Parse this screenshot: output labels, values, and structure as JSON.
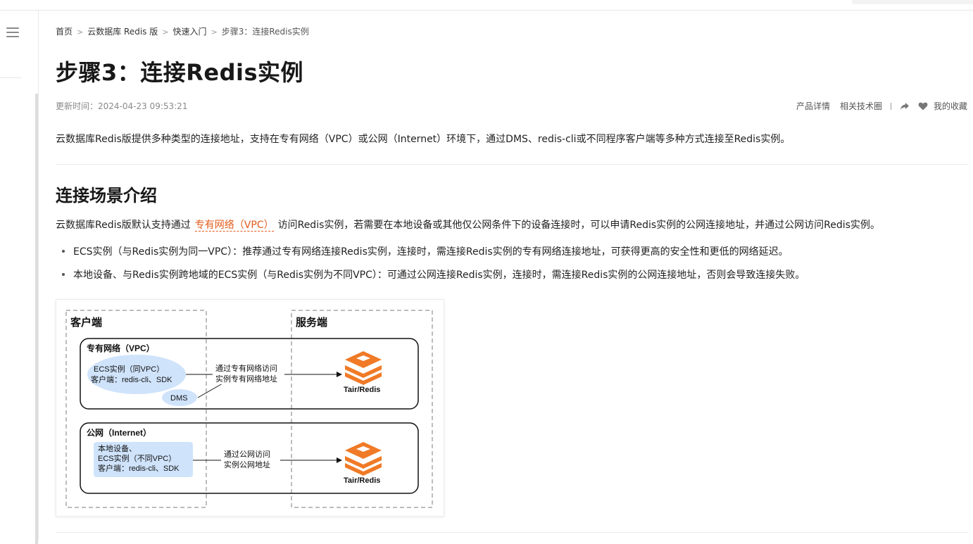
{
  "breadcrumb": {
    "items": [
      "首页",
      "云数据库 Redis 版",
      "快速入门"
    ],
    "current": "步骤3：连接Redis实例",
    "separator": ">"
  },
  "page": {
    "title": "步骤3：连接Redis实例",
    "updated": "更新时间：2024-04-23 09:53:21",
    "intro": "云数据库Redis版提供多种类型的连接地址，支持在专有网络（VPC）或公网（Internet）环境下，通过DMS、redis-cli或不同程序客户端等多种方式连接至Redis实例。"
  },
  "actions": {
    "product_detail": "产品详情",
    "tech_circle": "相关技术圈",
    "favorite": "我的收藏"
  },
  "section": {
    "heading": "连接场景介绍",
    "para_before": "云数据库Redis版默认支持通过",
    "para_link": "专有网络（VPC）",
    "para_after": "访问Redis实例，若需要在本地设备或其他仅公网条件下的设备连接时，可以申请Redis实例的公网连接地址，并通过公网访问Redis实例。",
    "bullets": [
      "ECS实例（与Redis实例为同一VPC）：推荐通过专有网络连接Redis实例，连接时，需连接Redis实例的专有网络连接地址，可获得更高的安全性和更低的网络延迟。",
      "本地设备、与Redis实例跨地域的ECS实例（与Redis实例为不同VPC）：可通过公网连接Redis实例，连接时，需连接Redis实例的公网连接地址，否则会导致连接失败。"
    ]
  },
  "diagram": {
    "client_label": "客户端",
    "server_label": "服务端",
    "vpc_box_label": "专有网络（VPC）",
    "ecs_line1": "ECS实例（同VPC）",
    "ecs_line2": "客户端：redis-cli、SDK",
    "dms_label": "DMS",
    "vpc_arrow_line1": "通过专有网络访问",
    "vpc_arrow_line2": "实例专有网络地址",
    "redis_label": "Tair/Redis",
    "public_box_label": "公网（Internet）",
    "local_line1": "本地设备、",
    "local_line2": "ECS实例（不同VPC）",
    "local_line3": "客户端：redis-cli、SDK",
    "public_arrow_line1": "通过公网访问",
    "public_arrow_line2": "实例公网地址",
    "colors": {
      "ellipse": "#cfe3fb",
      "redis": "#f07a26",
      "link": "#e25b1b"
    }
  }
}
